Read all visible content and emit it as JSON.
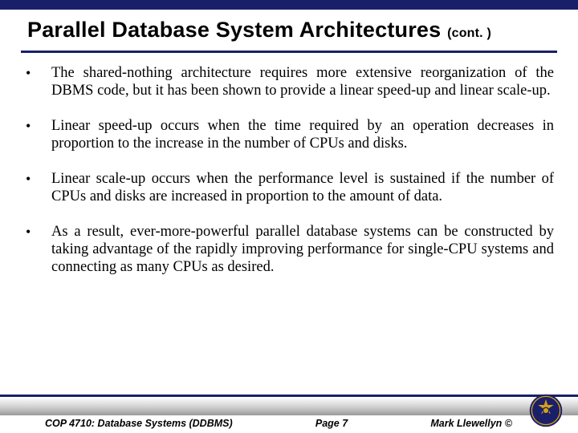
{
  "title": {
    "main": "Parallel Database System Architectures",
    "cont": "(cont. )"
  },
  "bullets": [
    "The shared-nothing architecture requires more extensive reorganization of the DBMS code, but it has been shown to provide a linear speed-up and linear scale-up.",
    "Linear speed-up occurs when the time required by an operation decreases in proportion to the increase in the number of CPUs and disks.",
    "Linear scale-up occurs when the performance level is sustained if the number of CPUs and disks are increased in proportion to the amount of data.",
    "As a result, ever-more-powerful parallel database systems can be constructed by taking advantage of the rapidly improving performance for single-CPU systems and connecting as many CPUs as desired."
  ],
  "footer": {
    "course": "COP 4710: Database Systems (DDBMS)",
    "page": "Page 7",
    "author": "Mark Llewellyn ©"
  },
  "colors": {
    "navy": "#1a1f6a",
    "gold": "#d4a017"
  }
}
